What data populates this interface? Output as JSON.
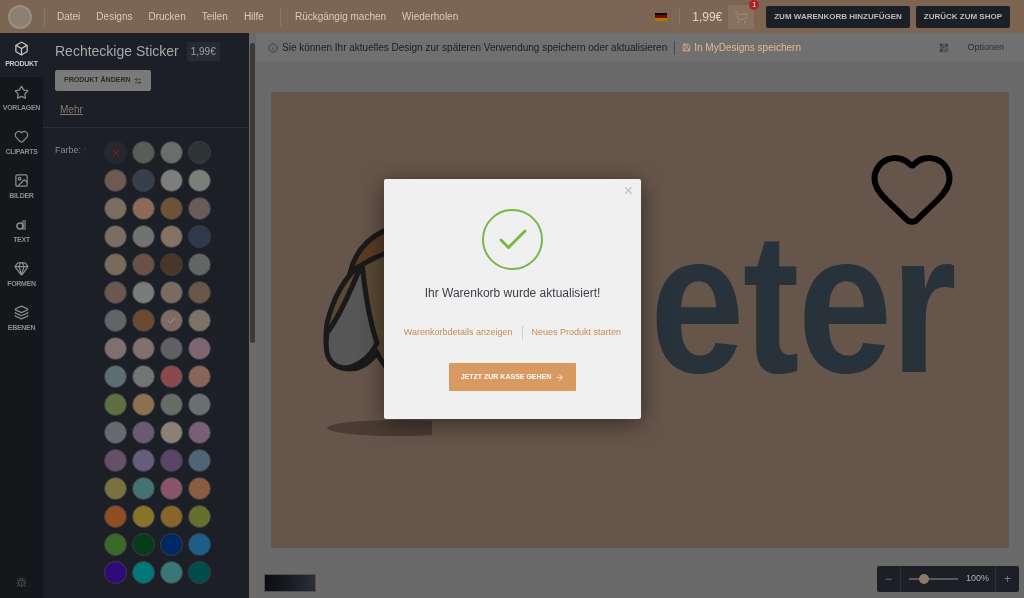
{
  "menu": [
    "Datei",
    "Designs",
    "Drucken",
    "Teilen",
    "Hilfe"
  ],
  "history": [
    "Rückgängig machen",
    "Wiederholen"
  ],
  "cart": {
    "price": "1,99€",
    "count": "1"
  },
  "header_buttons": [
    "ZUM WARENKORB HINZUFÜGEN",
    "ZURÜCK ZUM SHOP"
  ],
  "rail": [
    {
      "label": "PRODUKT",
      "selected": true,
      "kind": "cube"
    },
    {
      "label": "VORLAGEN",
      "selected": false,
      "kind": "star"
    },
    {
      "label": "CLIPARTS",
      "selected": false,
      "kind": "heart"
    },
    {
      "label": "BILDER",
      "selected": false,
      "kind": "image"
    },
    {
      "label": "TEXT",
      "selected": false,
      "kind": "text"
    },
    {
      "label": "FORMEN",
      "selected": false,
      "kind": "gem"
    },
    {
      "label": "EBENEN",
      "selected": false,
      "kind": "layers"
    }
  ],
  "product": {
    "title": "Rechteckige Sticker",
    "price": "1,99€",
    "change_button": "PRODUKT ÄNDERN",
    "more_link": "Mehr"
  },
  "color_label": "Farbe:",
  "required_mark": "*",
  "swatches": [
    {
      "kind": "none",
      "selected": false
    },
    {
      "color": "#5a5c58",
      "selected": false
    },
    {
      "color": "#6b6c6c",
      "selected": false
    },
    {
      "color": "#2e3434",
      "selected": false
    },
    {
      "color": "#6d5a52",
      "selected": false
    },
    {
      "color": "#37404a",
      "selected": false
    },
    {
      "color": "#7d7d7d",
      "selected": false
    },
    {
      "color": "#7a7f7a",
      "selected": false
    },
    {
      "color": "#7a6c5e",
      "selected": false
    },
    {
      "color": "#8a6a58",
      "selected": false
    },
    {
      "color": "#6e5238",
      "selected": false
    },
    {
      "color": "#6a5a5a",
      "selected": false
    },
    {
      "color": "#7a6e63",
      "selected": false
    },
    {
      "color": "#727272",
      "selected": false
    },
    {
      "color": "#857262",
      "selected": false
    },
    {
      "color": "#2e3a4c",
      "selected": false
    },
    {
      "color": "#7a6a5a",
      "selected": false
    },
    {
      "color": "#6a5048",
      "selected": false
    },
    {
      "color": "#4a3626",
      "selected": false
    },
    {
      "color": "#646666",
      "selected": false
    },
    {
      "color": "#6a5850",
      "selected": false
    },
    {
      "color": "#7a7a7a",
      "selected": false
    },
    {
      "color": "#7a6a60",
      "selected": false
    },
    {
      "color": "#6a5646",
      "selected": false
    },
    {
      "color": "#626466",
      "selected": false
    },
    {
      "color": "#6a4a32",
      "selected": false
    },
    {
      "color": "#7e6a60",
      "selected": true
    },
    {
      "color": "#7c7268",
      "selected": false
    },
    {
      "color": "#7e7070",
      "selected": false
    },
    {
      "color": "#826e6a",
      "selected": false
    },
    {
      "color": "#606062",
      "selected": false
    },
    {
      "color": "#7e6670",
      "selected": false
    },
    {
      "color": "#5a7070",
      "selected": false
    },
    {
      "color": "#727476",
      "selected": false
    },
    {
      "color": "#8a4a4c",
      "selected": false
    },
    {
      "color": "#8a6456",
      "selected": false
    },
    {
      "color": "#5e7040",
      "selected": false
    },
    {
      "color": "#8c7050",
      "selected": false
    },
    {
      "color": "#646e66",
      "selected": false
    },
    {
      "color": "#6a7072",
      "selected": false
    },
    {
      "color": "#6a6a6e",
      "selected": false
    },
    {
      "color": "#6a5a70",
      "selected": false
    },
    {
      "color": "#8a8074",
      "selected": false
    },
    {
      "color": "#7a5e76",
      "selected": false
    },
    {
      "color": "#645068",
      "selected": false
    },
    {
      "color": "#645e7a",
      "selected": false
    },
    {
      "color": "#5a4468",
      "selected": false
    },
    {
      "color": "#506478",
      "selected": false
    },
    {
      "color": "#7c7040",
      "selected": false
    },
    {
      "color": "#447270",
      "selected": false
    },
    {
      "color": "#8a5468",
      "selected": false
    },
    {
      "color": "#8a5c42",
      "selected": false
    },
    {
      "color": "#904c22",
      "selected": false
    },
    {
      "color": "#867428",
      "selected": false
    },
    {
      "color": "#8a6428",
      "selected": false
    },
    {
      "color": "#66702e",
      "selected": false
    },
    {
      "color": "#3a6a2a",
      "selected": false
    },
    {
      "color": "#063c1a",
      "selected": false
    },
    {
      "color": "#002864",
      "selected": false
    },
    {
      "color": "#1e5e86",
      "selected": false
    },
    {
      "color": "#2e0a7a",
      "selected": false
    },
    {
      "color": "#00787a",
      "selected": false
    },
    {
      "color": "#3a7676",
      "selected": false
    },
    {
      "color": "#004c4c",
      "selected": false
    }
  ],
  "info_bar": {
    "message": "Sie können Ihr aktuelles Design zur späteren Verwendung speichern oder aktualisieren",
    "save_link": "In MyDesigns speichern",
    "options": "Optionen"
  },
  "canvas": {
    "text": "eter"
  },
  "zoom": {
    "level": 0.3,
    "reading": "100%",
    "minus": "−",
    "plus": "+"
  },
  "modal": {
    "close": "×",
    "message": "Ihr Warenkorb wurde aktualisiert!",
    "links": [
      "Warenkorbdetails anzeigen",
      "Neues Produkt starten"
    ],
    "button": "JETZT ZUR KASSE GEHEN"
  }
}
